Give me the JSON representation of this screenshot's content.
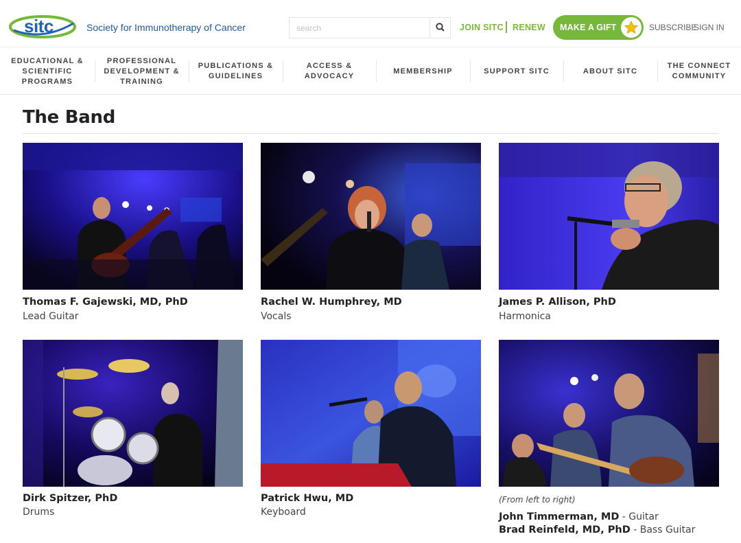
{
  "header": {
    "logo_text": "sitc",
    "org_name": "Society for Immunotherapy of Cancer",
    "search_placeholder": "search",
    "join_label": "JOIN SITC",
    "renew_label": "RENEW",
    "gift_label": "MAKE A GIFT",
    "subscribe_label": "SUBSCRIBE",
    "signin_label": "SIGN IN"
  },
  "nav": {
    "items": [
      {
        "label": "EDUCATIONAL &\nSCIENTIFIC\nPROGRAMS"
      },
      {
        "label": "PROFESSIONAL\nDEVELOPMENT &\nTRAINING"
      },
      {
        "label": "PUBLICATIONS &\nGUIDELINES"
      },
      {
        "label": "ACCESS &\nADVOCACY"
      },
      {
        "label": "MEMBERSHIP"
      },
      {
        "label": "SUPPORT SITC"
      },
      {
        "label": "ABOUT SITC"
      },
      {
        "label": "THE CONNECT\nCOMMUNITY"
      }
    ]
  },
  "page": {
    "title": "The Band"
  },
  "members": [
    {
      "name": "Thomas F. Gajewski, MD, PhD",
      "role": "Lead Guitar"
    },
    {
      "name": "Rachel W. Humphrey, MD",
      "role": "Vocals"
    },
    {
      "name": "James P. Allison, PhD",
      "role": "Harmonica"
    },
    {
      "name": "Dirk Spitzer, PhD",
      "role": "Drums"
    },
    {
      "name": "Patrick Hwu, MD",
      "role": "Keyboard"
    },
    {
      "note": "(From left to right)",
      "people": [
        {
          "name": "John Timmerman, MD",
          "role": " - Guitar"
        },
        {
          "name": "Brad Reinfeld, MD, PhD",
          "role": " - Bass Guitar"
        }
      ]
    }
  ],
  "colors": {
    "brand_blue": "#1f63b8",
    "brand_green": "#76b83a",
    "stage_blue": "#2a1fb8"
  }
}
